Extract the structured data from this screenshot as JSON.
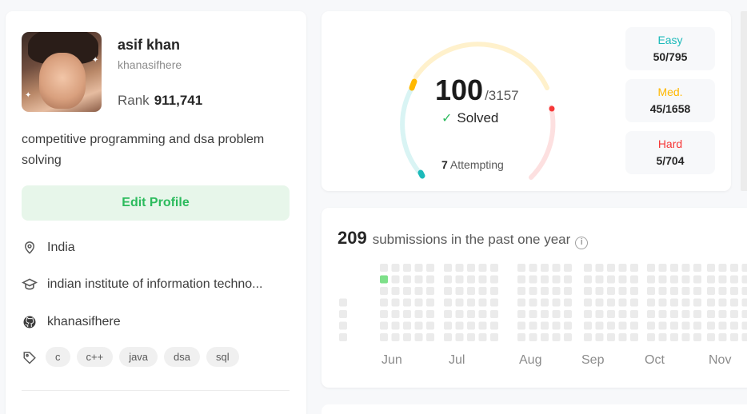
{
  "profile": {
    "name": "asif khan",
    "handle": "khanasifhere",
    "rank_label": "Rank",
    "rank_value": "911,741",
    "bio": "competitive programming and dsa problem solving",
    "edit_label": "Edit Profile",
    "location": "India",
    "school": "indian institute of information techno...",
    "github": "khanasifhere",
    "skills": [
      "c",
      "c++",
      "java",
      "dsa",
      "sql"
    ],
    "icons": {
      "location": "location-pin-icon",
      "school": "graduation-cap-icon",
      "github": "github-icon",
      "skills": "tag-icon"
    }
  },
  "progress": {
    "solved": "100",
    "total": "/3157",
    "solved_label": "Solved",
    "attempting_count": "7",
    "attempting_label": "Attempting",
    "difficulties": [
      {
        "label": "Easy",
        "value": "50/795",
        "color": "#1cbaba"
      },
      {
        "label": "Med.",
        "value": "45/1658",
        "color": "#ffb800"
      },
      {
        "label": "Hard",
        "value": "5/704",
        "color": "#f63737"
      }
    ]
  },
  "submissions": {
    "count": "209",
    "label": "submissions in the past one year",
    "months": [
      "Jun",
      "Jul",
      "Aug",
      "Sep",
      "Oct",
      "Nov"
    ],
    "active_color": "#7ee08a",
    "empty_color": "#ebebeb"
  },
  "colors": {
    "accent_green": "#2cbb5d",
    "easy_track": "#d9f4f4",
    "med_track": "#fff1cc",
    "hard_track": "#fde0e0"
  }
}
